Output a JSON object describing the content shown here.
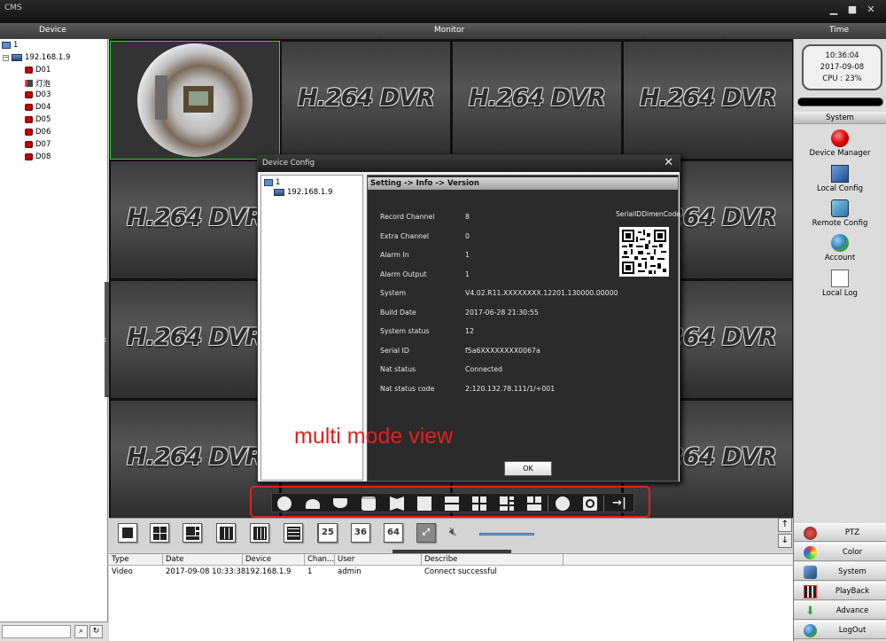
{
  "window": {
    "title": "CMS"
  },
  "header": {
    "device": "Device",
    "monitor": "Monitor",
    "time": "Time"
  },
  "tree": {
    "root": "1",
    "host": "192.168.1.9",
    "channels": [
      "D01",
      "灯泡",
      "D03",
      "D04",
      "D05",
      "D06",
      "D07",
      "D08"
    ]
  },
  "grid": {
    "cell_text": "H.264 DVR"
  },
  "clock": {
    "time": "10:36:04",
    "date": "2017-09-08",
    "cpu": "CPU : 23%"
  },
  "system_panel": {
    "header": "System",
    "items": [
      "Device Manager",
      "Local Config",
      "Remote Config",
      "Account",
      "Local Log"
    ]
  },
  "bottom_buttons": [
    "PTZ",
    "Color",
    "System",
    "PlayBack",
    "Advance",
    "LogOut"
  ],
  "layout_buttons": [
    "25",
    "36",
    "64"
  ],
  "log": {
    "columns": [
      "Type",
      "Date",
      "Device",
      "Chan...",
      "User",
      "Describe"
    ],
    "rows": [
      {
        "type": "Video",
        "date": "2017-09-08 10:33:38",
        "device": "192.168.1.9",
        "chan": "1",
        "user": "admin",
        "describe": "Connect successful"
      }
    ]
  },
  "dialog": {
    "title": "Device Config",
    "tree_root": "1",
    "tree_host": "192.168.1.9",
    "breadcrumb": "Setting -> Info -> Version",
    "qr_label": "SerialIDDimenCode",
    "fields": [
      {
        "label": "Record Channel",
        "value": "8"
      },
      {
        "label": "Extra Channel",
        "value": "0"
      },
      {
        "label": "Alarm In",
        "value": "1"
      },
      {
        "label": "Alarm Output",
        "value": "1"
      },
      {
        "label": "System",
        "value": "V4.02.R11.XXXXXXXX.12201.130000.00000"
      },
      {
        "label": "Build Date",
        "value": "2017-06-28 21:30:55"
      },
      {
        "label": "System status",
        "value": "12"
      },
      {
        "label": "Serial ID",
        "value": "f5a6XXXXXXXX0067a"
      },
      {
        "label": "Nat status",
        "value": "Connected"
      },
      {
        "label": "Nat status code",
        "value": "2:120.132.78.111/1/+001"
      }
    ],
    "ok_label": "OK"
  },
  "annotation": {
    "text": "multi mode view"
  },
  "colors": {
    "annotation": "#e02020",
    "active_cell_border": "#33cc33"
  }
}
